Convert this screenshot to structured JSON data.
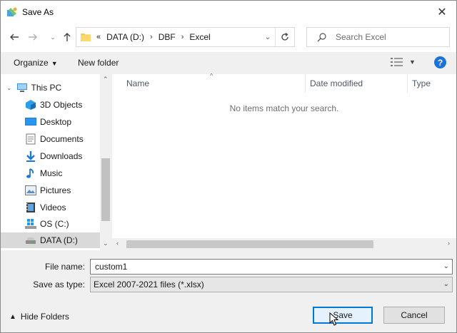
{
  "window": {
    "title": "Save As"
  },
  "address": {
    "prefix": "«",
    "crumbs": [
      "DATA (D:)",
      "DBF",
      "Excel"
    ]
  },
  "search": {
    "placeholder": "Search Excel"
  },
  "toolbar": {
    "organize_label": "Organize",
    "new_folder_label": "New folder"
  },
  "navpane": {
    "items": [
      {
        "label": "This PC",
        "icon": "pc-icon"
      },
      {
        "label": "3D Objects",
        "icon": "3d-objects-icon"
      },
      {
        "label": "Desktop",
        "icon": "desktop-icon"
      },
      {
        "label": "Documents",
        "icon": "documents-icon"
      },
      {
        "label": "Downloads",
        "icon": "downloads-icon"
      },
      {
        "label": "Music",
        "icon": "music-icon"
      },
      {
        "label": "Pictures",
        "icon": "pictures-icon"
      },
      {
        "label": "Videos",
        "icon": "videos-icon"
      },
      {
        "label": "OS (C:)",
        "icon": "drive-c-icon"
      },
      {
        "label": "DATA (D:)",
        "icon": "drive-d-icon",
        "selected": true
      }
    ]
  },
  "filepane": {
    "columns": [
      "Name",
      "Date modified",
      "Type"
    ],
    "empty_message": "No items match your search."
  },
  "form": {
    "file_name_label": "File name:",
    "file_name_value": "custom1",
    "save_type_label": "Save as type:",
    "save_type_value": "Excel 2007-2021 files (*.xlsx)"
  },
  "footer": {
    "hide_folders_label": "Hide Folders",
    "save_label": "Save",
    "cancel_label": "Cancel"
  },
  "colors": {
    "accent": "#0078d7",
    "help": "#1a73d6",
    "selected": "#d9d9d9"
  }
}
